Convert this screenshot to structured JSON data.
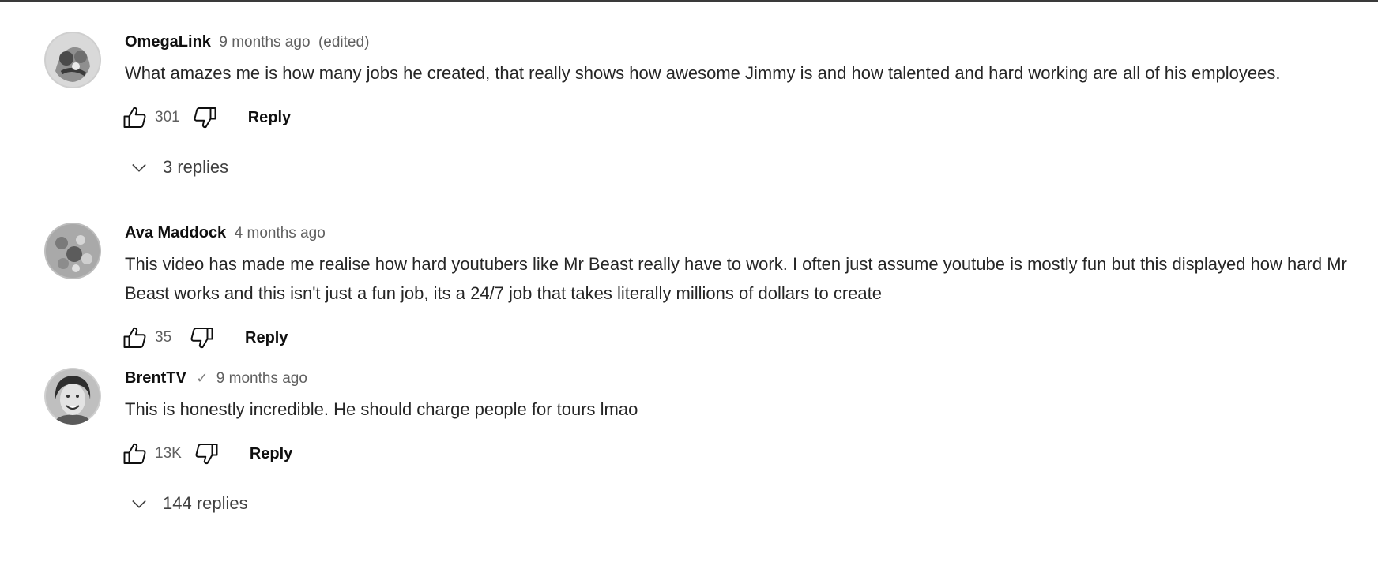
{
  "comments": [
    {
      "author": "OmegaLink",
      "time": "9 months ago",
      "edited": "(edited)",
      "text": "What amazes me is how many jobs he created, that really shows how awesome Jimmy is and how talented and hard working are all of his employees.",
      "likes": "301",
      "reply_label": "Reply",
      "replies_label": "3 replies"
    },
    {
      "author": "Ava Maddock",
      "time": "4 months ago",
      "text": "This video has made me realise how hard youtubers like Mr Beast really have to work. I often just assume youtube is mostly fun but this displayed how hard Mr Beast works and this isn't just a fun job, its a 24/7 job that takes literally millions of dollars to create",
      "likes": "35",
      "reply_label": "Reply"
    },
    {
      "author": "BrentTV",
      "verified_mark": "✓",
      "time": "9 months ago",
      "text": "This is honestly incredible. He should charge people for tours lmao",
      "likes": "13K",
      "reply_label": "Reply",
      "replies_label": "144 replies"
    }
  ],
  "icons": {
    "like": "thumbs-up-icon",
    "dislike": "thumbs-down-icon",
    "expand": "chevron-down-icon",
    "verified": "checkmark-icon"
  },
  "colors": {
    "text_primary": "#0f0f0f",
    "text_secondary": "#606060",
    "background": "#ffffff"
  }
}
